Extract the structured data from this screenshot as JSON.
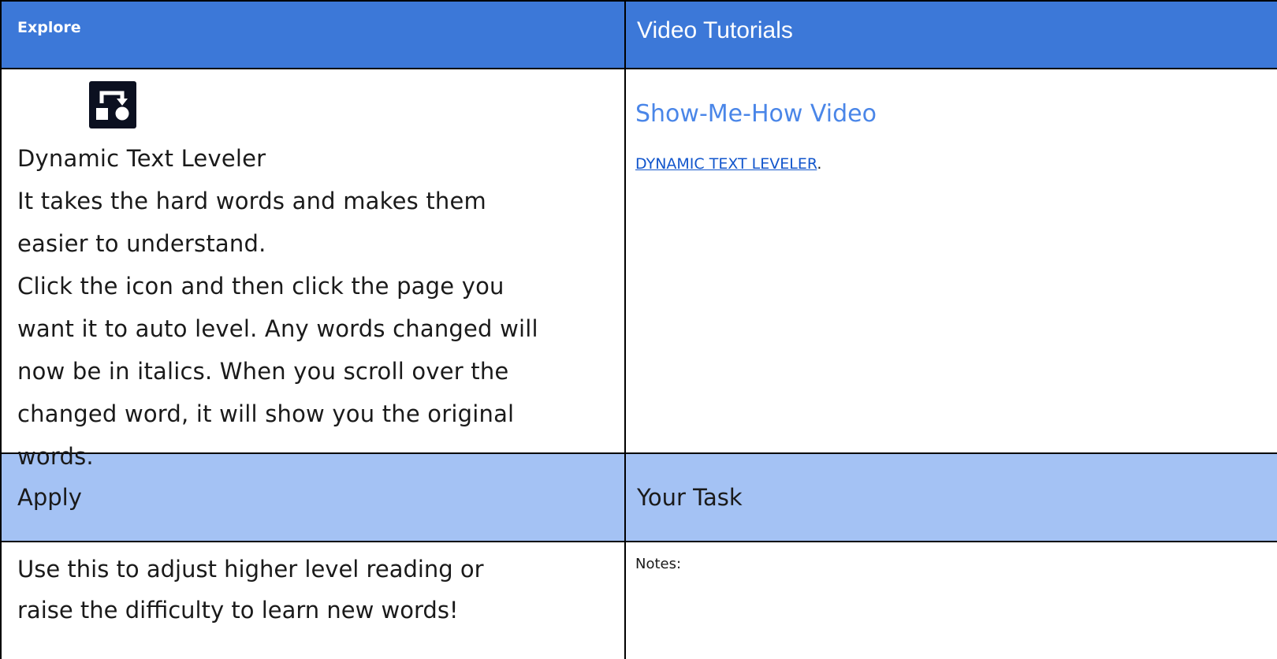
{
  "explore": {
    "header": "Explore",
    "tool_name": "Dynamic Text Leveler",
    "icon": "dynamic-text-leveler-icon",
    "description_lines": [
      "It takes the hard words and makes them",
      "easier to understand.",
      "Click the icon and then click the page you",
      "want it to auto level. Any words changed will",
      "now be in italics. When you scroll over the",
      "changed word, it will show you the original",
      "words."
    ]
  },
  "video": {
    "header": "Video Tutorials",
    "title": "Show-Me-How Video",
    "link_text": "DYNAMIC TEXT LEVELER",
    "link_suffix": "."
  },
  "apply": {
    "header": "Apply",
    "text_lines": [
      "Use this to adjust higher level reading or",
      "raise the difficulty to learn new words!"
    ]
  },
  "task": {
    "header": "Your Task",
    "notes_label": "Notes:"
  },
  "colors": {
    "header_dark": "#3c78d8",
    "header_light": "#a4c2f4",
    "link": "#1155cc",
    "subtitle": "#4a86e8"
  }
}
